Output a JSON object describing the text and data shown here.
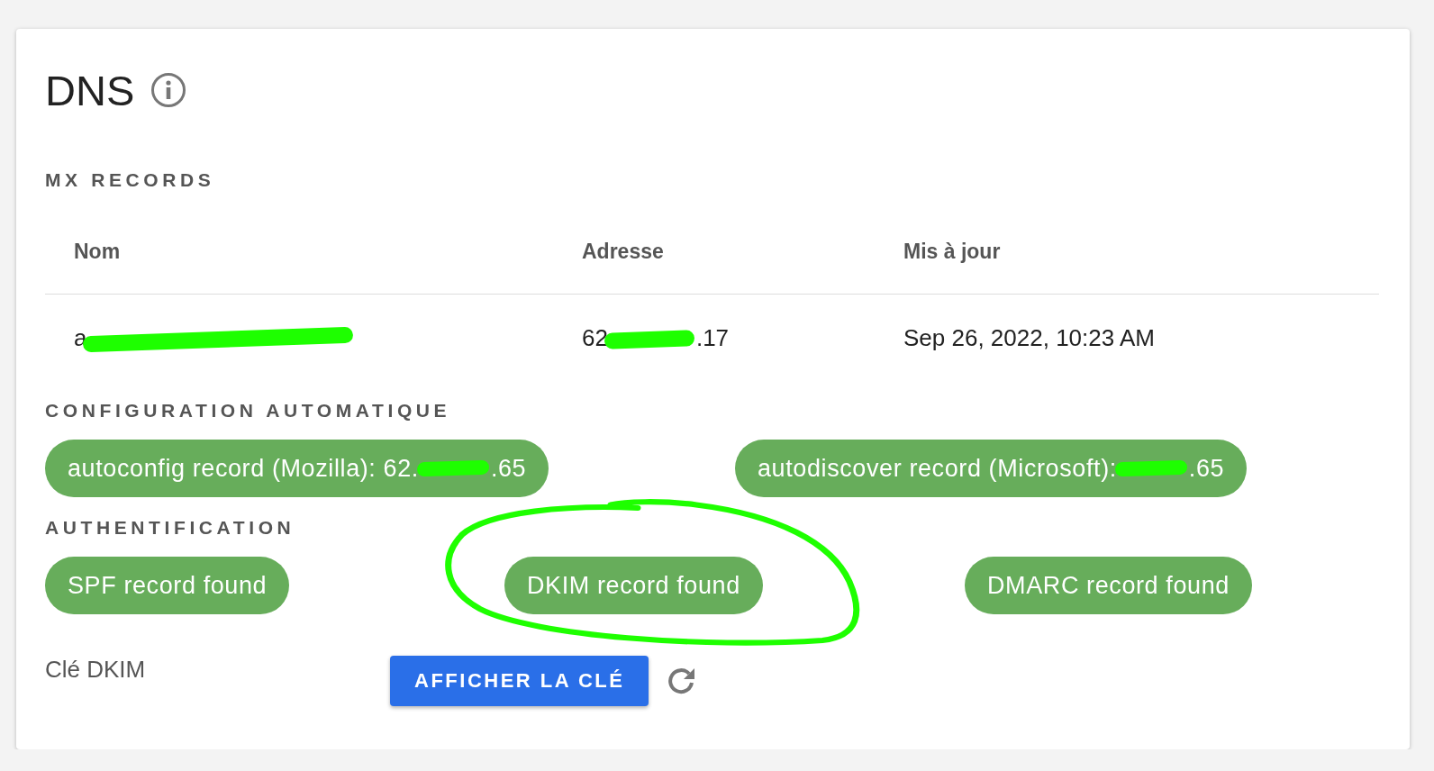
{
  "title": "DNS",
  "mx": {
    "heading": "MX RECORDS",
    "columns": [
      "Nom",
      "Adresse",
      "Mis à jour"
    ],
    "rows": [
      {
        "cells": [
          [
            {
              "kind": "text",
              "text": "a"
            },
            {
              "kind": "redaction"
            }
          ],
          [
            {
              "kind": "text",
              "text": "62"
            },
            {
              "kind": "redaction"
            },
            {
              "kind": "text",
              "text": ".17"
            }
          ],
          [
            {
              "kind": "text",
              "text": "Sep 26, 2022, 10:23 AM"
            }
          ]
        ]
      }
    ]
  },
  "autoconfig": {
    "heading": "CONFIGURATION AUTOMATIQUE",
    "chips": [
      [
        {
          "kind": "text",
          "text": "autoconfig record (Mozilla): 62."
        },
        {
          "kind": "redaction"
        },
        {
          "kind": "text",
          "text": ".65"
        }
      ],
      [
        {
          "kind": "text",
          "text": "autodiscover record (Microsoft):"
        },
        {
          "kind": "redaction"
        },
        {
          "kind": "text",
          "text": ".65"
        }
      ]
    ]
  },
  "auth": {
    "heading": "AUTHENTIFICATION",
    "chips": [
      [
        {
          "kind": "text",
          "text": "SPF record found"
        }
      ],
      [
        {
          "kind": "text",
          "text": "DKIM record found"
        }
      ],
      [
        {
          "kind": "text",
          "text": "DMARC record found"
        }
      ]
    ]
  },
  "dkim": {
    "label": "Clé DKIM",
    "button": "AFFICHER LA CLÉ"
  }
}
